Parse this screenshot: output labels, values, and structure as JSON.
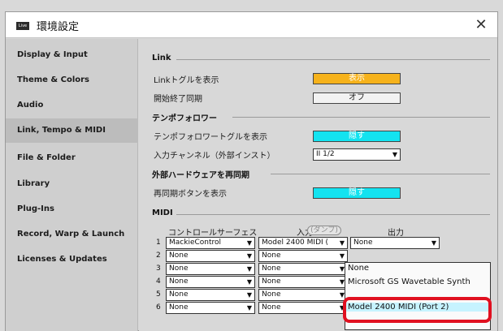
{
  "window": {
    "title": "環境設定",
    "app_icon_text": "Live"
  },
  "sidebar": {
    "items": [
      {
        "label": "Display & Input"
      },
      {
        "label": "Theme & Colors"
      },
      {
        "label": "Audio"
      },
      {
        "label": "Link, Tempo & MIDI",
        "active": true
      },
      {
        "label": "File & Folder"
      },
      {
        "label": "Library"
      },
      {
        "label": "Plug-Ins"
      },
      {
        "label": "Record, Warp & Launch"
      },
      {
        "label": "Licenses & Updates"
      }
    ]
  },
  "link": {
    "section": "Link",
    "show_toggle_label": "Linkトグルを表示",
    "show_toggle_value": "表示",
    "start_stop_label": "開始終了同期",
    "start_stop_value": "オフ"
  },
  "tempo_follower": {
    "section": "テンポフォロワー",
    "toggle_label": "テンポフォロワートグルを表示",
    "toggle_value": "隠す",
    "input_channel_label": "入力チャンネル（外部インスト）",
    "input_channel_value": "II 1/2"
  },
  "resync": {
    "section": "外部ハードウェアを再同期",
    "button_label": "再同期ボタンを表示",
    "button_value": "隠す"
  },
  "midi": {
    "section": "MIDI",
    "headers": {
      "control_surface": "コントロールサーフェス",
      "input": "入力",
      "output": "出力"
    },
    "dump_label": "(ダンプ)",
    "rows": [
      {
        "num": "1",
        "surface": "MackieControl",
        "input": "Model 2400 MIDI (",
        "output": "None"
      },
      {
        "num": "2",
        "surface": "None",
        "input": "None",
        "output": ""
      },
      {
        "num": "3",
        "surface": "None",
        "input": "None",
        "output": ""
      },
      {
        "num": "4",
        "surface": "None",
        "input": "None",
        "output": ""
      },
      {
        "num": "5",
        "surface": "None",
        "input": "None",
        "output": ""
      },
      {
        "num": "6",
        "surface": "None",
        "input": "None",
        "output": ""
      }
    ],
    "output_dropdown": {
      "options": [
        "None",
        "Microsoft GS Wavetable Synth",
        "Model 2400 MIDI (Port 2)"
      ],
      "highlighted": "Model 2400 MIDI (Port 2)"
    }
  },
  "colors": {
    "orange": "#f6b21b",
    "cyan": "#13e3f0",
    "highlight_red": "#e01020"
  }
}
